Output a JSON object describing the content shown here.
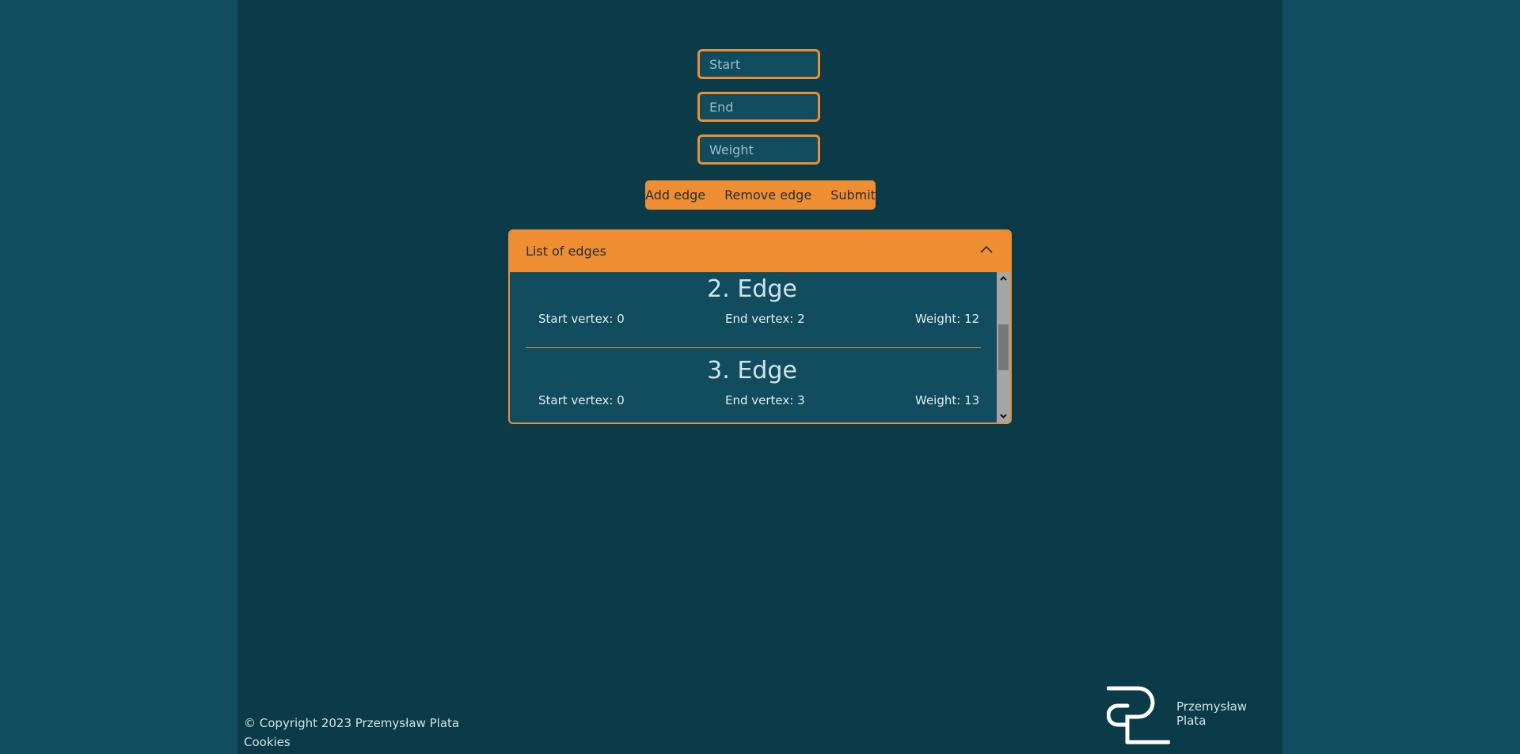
{
  "form": {
    "start_placeholder": "Start",
    "end_placeholder": "End",
    "weight_placeholder": "Weight",
    "start_value": "",
    "end_value": "",
    "weight_value": ""
  },
  "buttons": {
    "add_edge": "Add edge",
    "remove_edge": "Remove edge",
    "submit": "Submit"
  },
  "accordion": {
    "title": "List of edges",
    "expanded": true,
    "edges": [
      {
        "title": "2. Edge",
        "start_label": "Start vertex: 0",
        "end_label": "End vertex: 2",
        "weight_label": "Weight: 12"
      },
      {
        "title": "3. Edge",
        "start_label": "Start vertex: 0",
        "end_label": "End vertex: 3",
        "weight_label": "Weight: 13"
      }
    ]
  },
  "footer": {
    "copyright": "© Copyright 2023 Przemysław Plata",
    "cookies": "Cookies",
    "logo_line1": "Przemysław",
    "logo_line2": "Plata"
  },
  "colors": {
    "outer_background": "#114d5f",
    "page_background": "#0b3a48",
    "accent": "#ef8d32",
    "text": "#cfe4ea"
  }
}
